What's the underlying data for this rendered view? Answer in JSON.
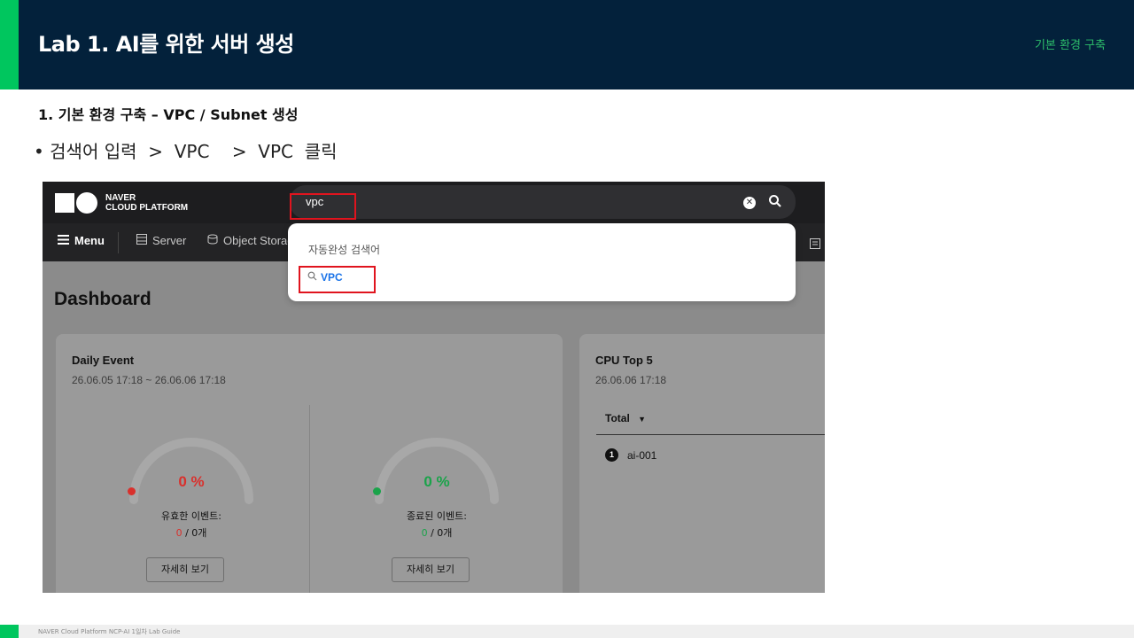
{
  "header": {
    "title": "Lab 1. AI를 위한 서버 생성",
    "right_label": "기본 환경 구축"
  },
  "section": {
    "heading": "1.  기본 환경 구축 – VPC / Subnet 생성",
    "bullet": "• 검색어 입력  >  VPC    >  VPC  클릭"
  },
  "screenshot": {
    "logo": {
      "line1": "NAVER",
      "line2": "CLOUD PLATFORM"
    },
    "search": {
      "value": "vpc"
    },
    "nav": {
      "menu": "Menu",
      "server": "Server",
      "object_storage": "Object Storag"
    },
    "autocomplete": {
      "title": "자동완성 검색어",
      "item": "VPC"
    },
    "dashboard": {
      "title": "Dashboard",
      "daily_event": {
        "title": "Daily Event",
        "range": "26.06.05 17:18 ~ 26.06.06 17:18",
        "valid": {
          "percent": "0 %",
          "label": "유효한 이벤트:",
          "count_highlight": "0",
          "count_rest": " / 0개",
          "button": "자세히 보기",
          "color": "#d9302c",
          "fraction": 0
        },
        "done": {
          "percent": "0 %",
          "label": "종료된 이벤트:",
          "count_highlight": "0",
          "count_rest": " / 0개",
          "button": "자세히 보기",
          "color": "#1aa34a",
          "fraction": 0
        }
      },
      "cpu_top5": {
        "title": "CPU Top 5",
        "time": "26.06.06 17:18",
        "dropdown": "Total",
        "items": [
          {
            "rank": "1",
            "name": "ai-001"
          }
        ]
      }
    }
  },
  "footer": {
    "text": "NAVER Cloud Platform  NCP-AI 1일차 Lab Guide"
  },
  "colors": {
    "header_bg": "#03213b",
    "accent": "#00c65e",
    "highlight": "#e0141e",
    "link": "#1a73e8"
  }
}
